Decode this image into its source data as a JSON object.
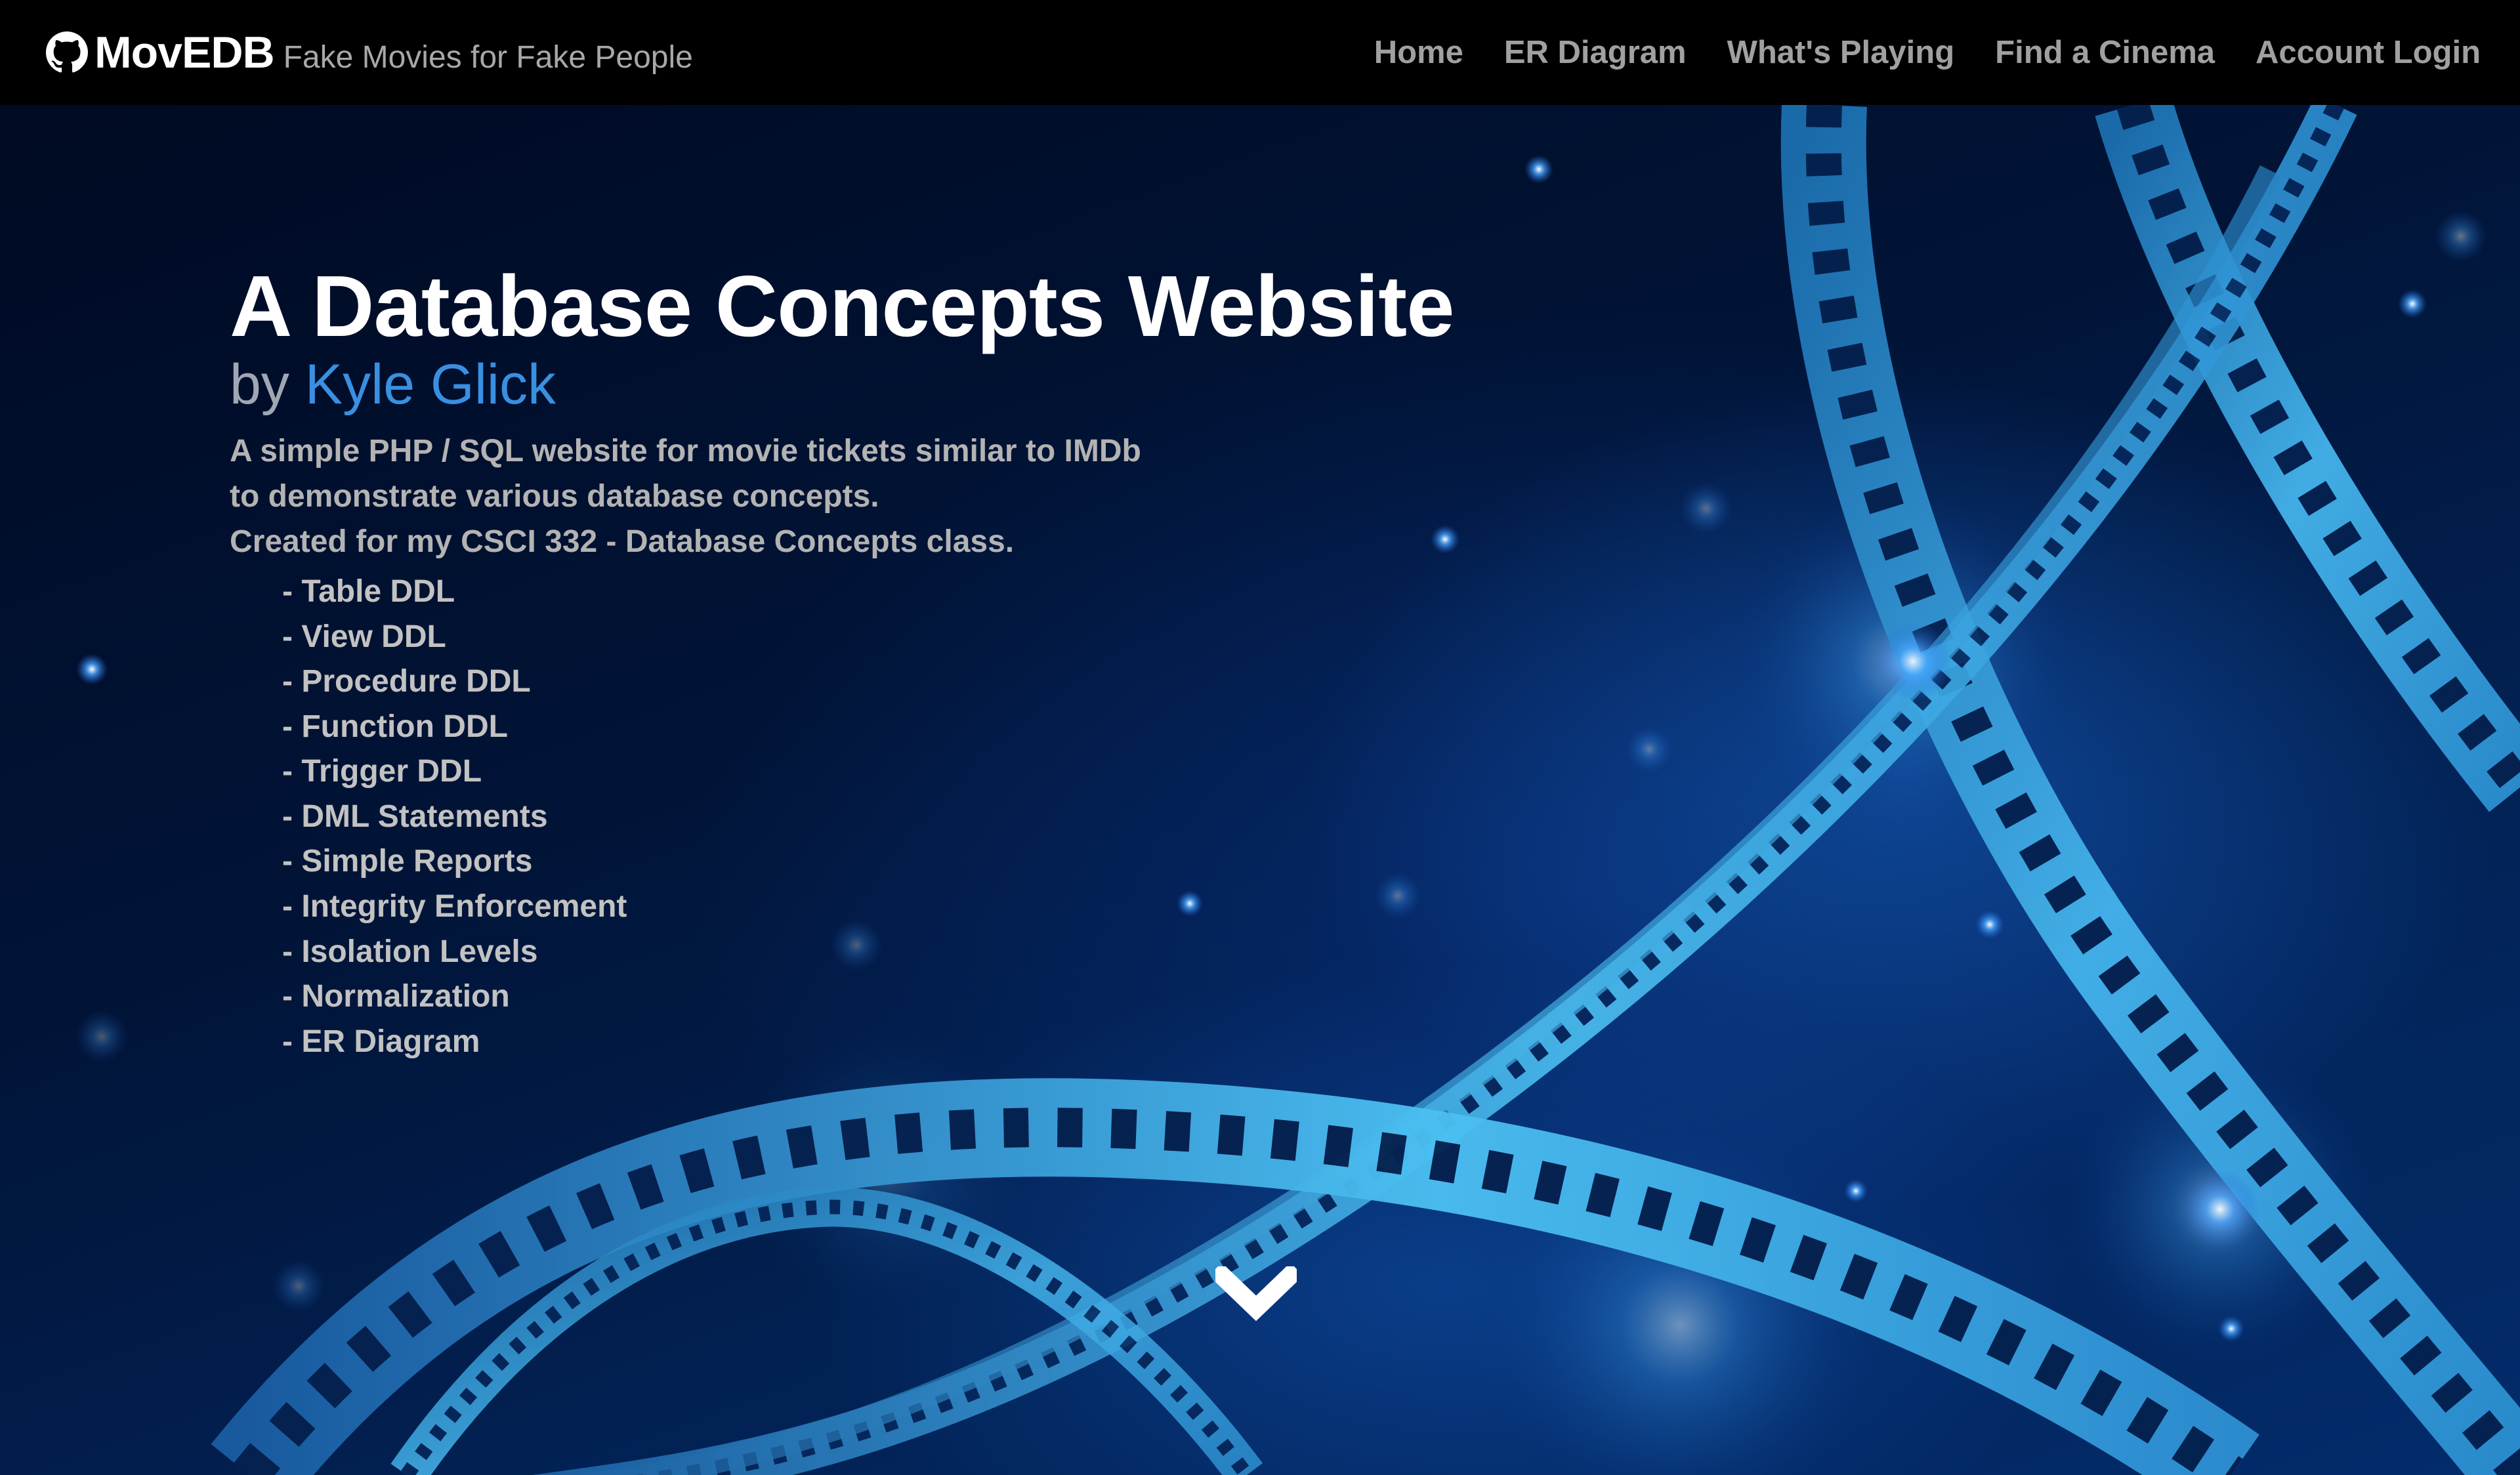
{
  "navbar": {
    "brand_name": "MovEDB",
    "tagline": "Fake Movies for Fake People",
    "links": [
      {
        "label": "Home"
      },
      {
        "label": "ER Diagram"
      },
      {
        "label": "What's Playing"
      },
      {
        "label": "Find a Cinema"
      },
      {
        "label": "Account Login"
      }
    ]
  },
  "hero": {
    "title": "A Database Concepts Website",
    "by": "by ",
    "author": "Kyle Glick",
    "description": [
      "A simple PHP / SQL website for movie tickets similar to IMDb",
      "to demonstrate various database concepts.",
      "Created for my CSCI 332 - Database Concepts class."
    ],
    "features": [
      "- Table DDL",
      "- View DDL",
      "- Procedure DDL",
      "- Function DDL",
      "- Trigger DDL",
      "- DML Statements",
      "- Simple Reports",
      "- Integrity Enforcement",
      "- Isolation Levels",
      "- Normalization",
      "- ER Diagram"
    ]
  },
  "icons": {
    "brand": "github-icon",
    "scroll": "chevron-down-icon"
  },
  "colors": {
    "navbar_bg": "#000000",
    "accent_link": "#3a8fe0",
    "film_strip": "#3fa9e0"
  }
}
